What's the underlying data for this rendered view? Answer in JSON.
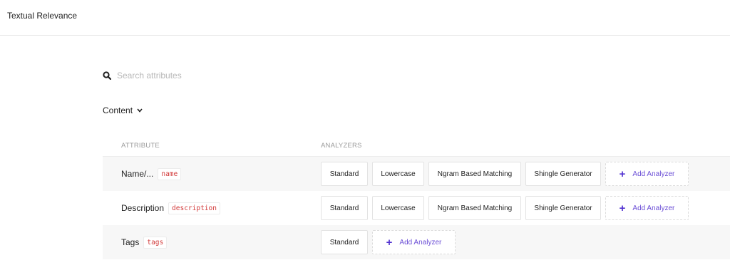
{
  "header": {
    "title": "Textual Relevance"
  },
  "search": {
    "placeholder": "Search attributes",
    "value": ""
  },
  "section": {
    "label": "Content"
  },
  "table": {
    "columns": {
      "attribute": "ATTRIBUTE",
      "analyzers": "ANALYZERS"
    },
    "rows": [
      {
        "label": "Name/...",
        "field": "name",
        "analyzers": [
          "Standard",
          "Lowercase",
          "Ngram Based Matching",
          "Shingle Generator"
        ],
        "add_label": "Add Analyzer"
      },
      {
        "label": "Description",
        "field": "description",
        "analyzers": [
          "Standard",
          "Lowercase",
          "Ngram Based Matching",
          "Shingle Generator"
        ],
        "add_label": "Add Analyzer"
      },
      {
        "label": "Tags",
        "field": "tags",
        "analyzers": [
          "Standard"
        ],
        "add_label": "Add Analyzer"
      }
    ]
  },
  "icons": {
    "search": "search-icon",
    "chevron": "chevron-down-icon",
    "add": "plus-icon"
  },
  "colors": {
    "accent": "#4f2fd0",
    "code": "#d23b3b",
    "row_shade": "#f7f7f7"
  }
}
